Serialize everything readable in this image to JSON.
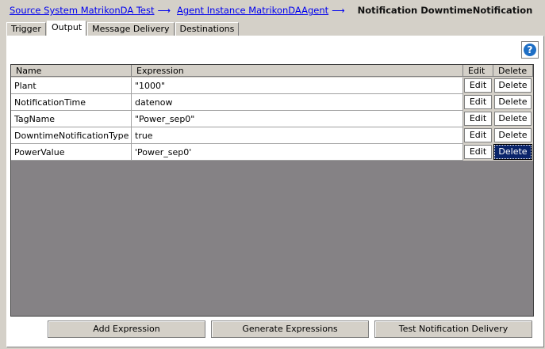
{
  "breadcrumb": {
    "link1": "Source System MatrikonDA Test",
    "link2": "Agent Instance MatrikonDAAgent",
    "arrow": "⟶",
    "current": "Notification DowntimeNotification"
  },
  "tabs": [
    "Trigger",
    "Output",
    "Message Delivery",
    "Destinations"
  ],
  "active_tab": "Output",
  "help": {
    "symbol": "?"
  },
  "table": {
    "headers": {
      "name": "Name",
      "expression": "Expression",
      "edit": "Edit",
      "delete": "Delete"
    },
    "rows": [
      {
        "name": "Plant",
        "expression": "\"1000\"",
        "edit": "Edit",
        "delete": "Delete"
      },
      {
        "name": "NotificationTime",
        "expression": "datenow",
        "edit": "Edit",
        "delete": "Delete"
      },
      {
        "name": "TagName",
        "expression": "\"Power_sep0\"",
        "edit": "Edit",
        "delete": "Delete"
      },
      {
        "name": "DowntimeNotificationType",
        "expression": "true",
        "edit": "Edit",
        "delete": "Delete"
      },
      {
        "name": "PowerValue",
        "expression": "'Power_sep0'",
        "edit": "Edit",
        "delete": "Delete"
      }
    ],
    "selected_delete_row": 4
  },
  "buttons": {
    "add": "Add Expression",
    "generate": "Generate Expressions",
    "test": "Test Notification Delivery"
  },
  "colors": {
    "grid_background": "#858285",
    "link": "#0000ee",
    "selected": "#0a246a",
    "help": "#1f6fc5"
  }
}
